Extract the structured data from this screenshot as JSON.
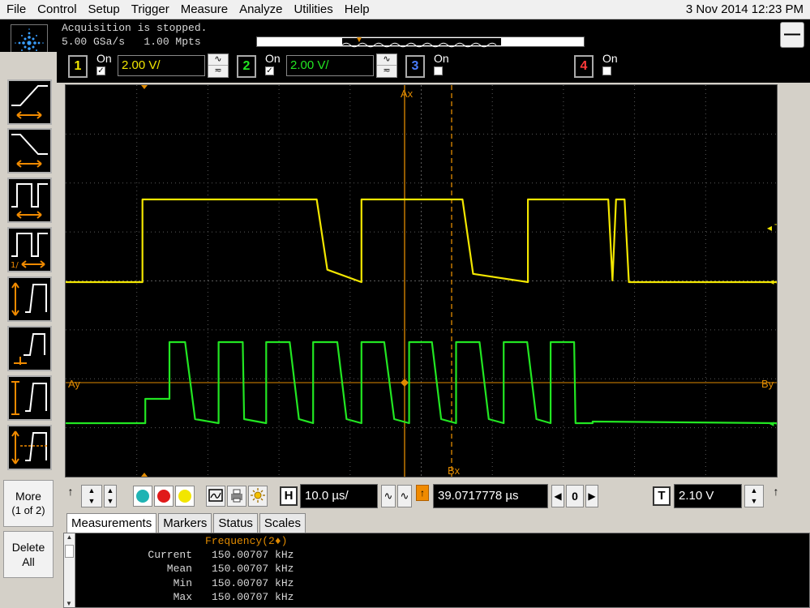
{
  "menu": [
    "File",
    "Control",
    "Setup",
    "Trigger",
    "Measure",
    "Analyze",
    "Utilities",
    "Help"
  ],
  "datetime": "3 Nov 2014 12:23 PM",
  "acquisition": {
    "status": "Acquisition is stopped.",
    "rate": "5.00 GSa/s",
    "depth": "1.00 Mpts"
  },
  "channels": [
    {
      "num": "1",
      "on_label": "On",
      "enabled": true,
      "scale": "2.00 V/",
      "color": "#f2e600"
    },
    {
      "num": "2",
      "on_label": "On",
      "enabled": true,
      "scale": "2.00 V/",
      "color": "#22e622"
    },
    {
      "num": "3",
      "on_label": "On",
      "enabled": false,
      "color": "#4a7dff"
    },
    {
      "num": "4",
      "on_label": "On",
      "enabled": false,
      "color": "#ff3a3a"
    }
  ],
  "side_buttons": {
    "more": "More",
    "more_page": "(1 of 2)",
    "delete": "Delete",
    "delete_all": "All"
  },
  "graticule_labels": {
    "ax": "Ax",
    "bx": "Bx",
    "ay": "Ay",
    "by": "By",
    "trig": "T"
  },
  "horizontal": {
    "h_label": "H",
    "timebase": "10.0 µs/",
    "delay": "39.0717778 µs",
    "delay_ref": "0",
    "trig_label": "T",
    "trig_level": "2.10 V"
  },
  "tabs": [
    "Measurements",
    "Markers",
    "Status",
    "Scales"
  ],
  "measurement": {
    "title": "Frequency(2♦)",
    "rows": [
      {
        "label": "Current",
        "value": "150.00707 kHz"
      },
      {
        "label": "Mean",
        "value": "150.00707 kHz"
      },
      {
        "label": "Min",
        "value": "150.00707 kHz"
      },
      {
        "label": "Max",
        "value": "150.00707 kHz"
      }
    ]
  },
  "colors": {
    "ch1": "#f2e600",
    "ch2": "#22e622",
    "marker": "#e08a00",
    "grid": "#5a5a5a"
  },
  "waveform_ch1": [
    [
      0,
      0
    ],
    [
      10.8,
      0
    ],
    [
      10.8,
      1
    ],
    [
      35.3,
      1
    ],
    [
      36.8,
      0.15
    ],
    [
      41.6,
      0
    ],
    [
      41.6,
      1
    ],
    [
      55.8,
      1
    ],
    [
      57.3,
      0.1
    ],
    [
      65,
      0
    ],
    [
      65,
      1
    ],
    [
      76.3,
      1
    ],
    [
      76.9,
      0.02
    ],
    [
      77.4,
      1
    ],
    [
      78.6,
      1
    ],
    [
      79.2,
      0
    ],
    [
      100,
      0
    ]
  ],
  "waveform_ch2": [
    [
      0,
      0
    ],
    [
      11.2,
      0
    ],
    [
      11.2,
      0.3
    ],
    [
      14.6,
      0.3
    ],
    [
      14.6,
      1
    ],
    [
      16.8,
      1
    ],
    [
      18.2,
      0.05
    ],
    [
      21.5,
      0
    ],
    [
      21.5,
      1
    ],
    [
      24.9,
      1
    ],
    [
      25.1,
      0.05
    ],
    [
      28.2,
      0
    ],
    [
      28.2,
      1
    ],
    [
      31.5,
      1
    ],
    [
      32.8,
      0.05
    ],
    [
      34.8,
      0
    ],
    [
      34.8,
      1
    ],
    [
      38.2,
      1
    ],
    [
      39.5,
      0.05
    ],
    [
      41.6,
      0
    ],
    [
      41.6,
      1
    ],
    [
      44.8,
      1
    ],
    [
      46.2,
      0.05
    ],
    [
      48.3,
      0
    ],
    [
      48.3,
      1
    ],
    [
      51.5,
      1
    ],
    [
      52.8,
      0.05
    ],
    [
      54.9,
      0
    ],
    [
      54.9,
      1
    ],
    [
      58.2,
      1
    ],
    [
      59.5,
      0.05
    ],
    [
      61.6,
      0
    ],
    [
      61.6,
      1
    ],
    [
      64.9,
      1
    ],
    [
      66.2,
      0.05
    ],
    [
      68.2,
      0
    ],
    [
      68.2,
      1
    ],
    [
      71.5,
      1
    ],
    [
      71.7,
      0
    ],
    [
      74.1,
      0
    ],
    [
      74.1,
      0.02
    ],
    [
      100,
      0
    ]
  ]
}
